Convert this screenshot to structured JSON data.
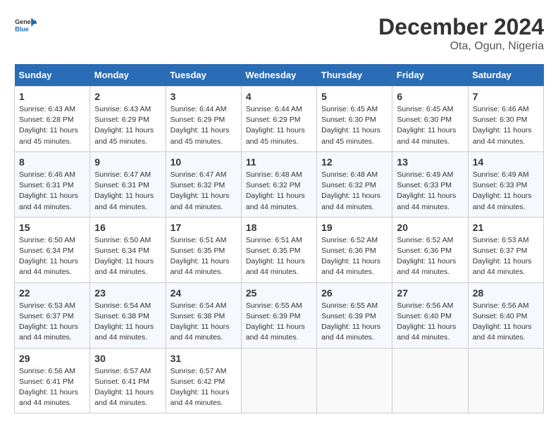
{
  "header": {
    "logo_general": "General",
    "logo_blue": "Blue",
    "month_year": "December 2024",
    "location": "Ota, Ogun, Nigeria"
  },
  "weekdays": [
    "Sunday",
    "Monday",
    "Tuesday",
    "Wednesday",
    "Thursday",
    "Friday",
    "Saturday"
  ],
  "weeks": [
    [
      {
        "day": 1,
        "sunrise": "6:43 AM",
        "sunset": "6:28 PM",
        "daylight": "11 hours and 45 minutes."
      },
      {
        "day": 2,
        "sunrise": "6:43 AM",
        "sunset": "6:29 PM",
        "daylight": "11 hours and 45 minutes."
      },
      {
        "day": 3,
        "sunrise": "6:44 AM",
        "sunset": "6:29 PM",
        "daylight": "11 hours and 45 minutes."
      },
      {
        "day": 4,
        "sunrise": "6:44 AM",
        "sunset": "6:29 PM",
        "daylight": "11 hours and 45 minutes."
      },
      {
        "day": 5,
        "sunrise": "6:45 AM",
        "sunset": "6:30 PM",
        "daylight": "11 hours and 45 minutes."
      },
      {
        "day": 6,
        "sunrise": "6:45 AM",
        "sunset": "6:30 PM",
        "daylight": "11 hours and 44 minutes."
      },
      {
        "day": 7,
        "sunrise": "6:46 AM",
        "sunset": "6:30 PM",
        "daylight": "11 hours and 44 minutes."
      }
    ],
    [
      {
        "day": 8,
        "sunrise": "6:46 AM",
        "sunset": "6:31 PM",
        "daylight": "11 hours and 44 minutes."
      },
      {
        "day": 9,
        "sunrise": "6:47 AM",
        "sunset": "6:31 PM",
        "daylight": "11 hours and 44 minutes."
      },
      {
        "day": 10,
        "sunrise": "6:47 AM",
        "sunset": "6:32 PM",
        "daylight": "11 hours and 44 minutes."
      },
      {
        "day": 11,
        "sunrise": "6:48 AM",
        "sunset": "6:32 PM",
        "daylight": "11 hours and 44 minutes."
      },
      {
        "day": 12,
        "sunrise": "6:48 AM",
        "sunset": "6:32 PM",
        "daylight": "11 hours and 44 minutes."
      },
      {
        "day": 13,
        "sunrise": "6:49 AM",
        "sunset": "6:33 PM",
        "daylight": "11 hours and 44 minutes."
      },
      {
        "day": 14,
        "sunrise": "6:49 AM",
        "sunset": "6:33 PM",
        "daylight": "11 hours and 44 minutes."
      }
    ],
    [
      {
        "day": 15,
        "sunrise": "6:50 AM",
        "sunset": "6:34 PM",
        "daylight": "11 hours and 44 minutes."
      },
      {
        "day": 16,
        "sunrise": "6:50 AM",
        "sunset": "6:34 PM",
        "daylight": "11 hours and 44 minutes."
      },
      {
        "day": 17,
        "sunrise": "6:51 AM",
        "sunset": "6:35 PM",
        "daylight": "11 hours and 44 minutes."
      },
      {
        "day": 18,
        "sunrise": "6:51 AM",
        "sunset": "6:35 PM",
        "daylight": "11 hours and 44 minutes."
      },
      {
        "day": 19,
        "sunrise": "6:52 AM",
        "sunset": "6:36 PM",
        "daylight": "11 hours and 44 minutes."
      },
      {
        "day": 20,
        "sunrise": "6:52 AM",
        "sunset": "6:36 PM",
        "daylight": "11 hours and 44 minutes."
      },
      {
        "day": 21,
        "sunrise": "6:53 AM",
        "sunset": "6:37 PM",
        "daylight": "11 hours and 44 minutes."
      }
    ],
    [
      {
        "day": 22,
        "sunrise": "6:53 AM",
        "sunset": "6:37 PM",
        "daylight": "11 hours and 44 minutes."
      },
      {
        "day": 23,
        "sunrise": "6:54 AM",
        "sunset": "6:38 PM",
        "daylight": "11 hours and 44 minutes."
      },
      {
        "day": 24,
        "sunrise": "6:54 AM",
        "sunset": "6:38 PM",
        "daylight": "11 hours and 44 minutes."
      },
      {
        "day": 25,
        "sunrise": "6:55 AM",
        "sunset": "6:39 PM",
        "daylight": "11 hours and 44 minutes."
      },
      {
        "day": 26,
        "sunrise": "6:55 AM",
        "sunset": "6:39 PM",
        "daylight": "11 hours and 44 minutes."
      },
      {
        "day": 27,
        "sunrise": "6:56 AM",
        "sunset": "6:40 PM",
        "daylight": "11 hours and 44 minutes."
      },
      {
        "day": 28,
        "sunrise": "6:56 AM",
        "sunset": "6:40 PM",
        "daylight": "11 hours and 44 minutes."
      }
    ],
    [
      {
        "day": 29,
        "sunrise": "6:56 AM",
        "sunset": "6:41 PM",
        "daylight": "11 hours and 44 minutes."
      },
      {
        "day": 30,
        "sunrise": "6:57 AM",
        "sunset": "6:41 PM",
        "daylight": "11 hours and 44 minutes."
      },
      {
        "day": 31,
        "sunrise": "6:57 AM",
        "sunset": "6:42 PM",
        "daylight": "11 hours and 44 minutes."
      },
      null,
      null,
      null,
      null
    ]
  ],
  "labels": {
    "sunrise": "Sunrise:",
    "sunset": "Sunset:",
    "daylight": "Daylight:"
  }
}
